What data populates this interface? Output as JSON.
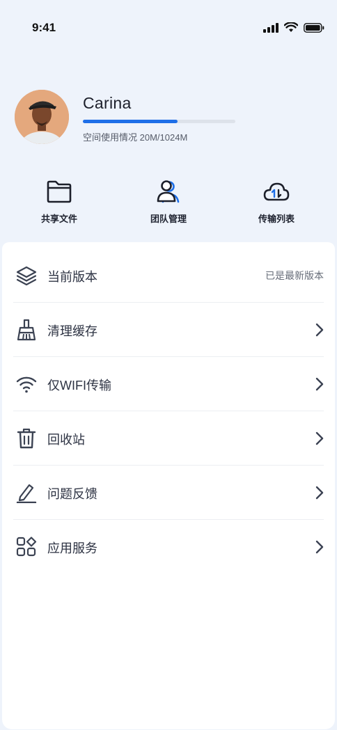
{
  "status": {
    "time": "9:41"
  },
  "profile": {
    "name": "Carina",
    "usage_label": "空间使用情况",
    "usage_amount": "20M/1024M",
    "usage_fraction": 0.62
  },
  "quick_actions": [
    {
      "label": "共享文件",
      "icon": "folder-icon"
    },
    {
      "label": "团队管理",
      "icon": "team-icon"
    },
    {
      "label": "传输列表",
      "icon": "cloud-transfer-icon"
    }
  ],
  "menu": [
    {
      "label": "当前版本",
      "icon": "layers-icon",
      "value": "已是最新版本"
    },
    {
      "label": "清理缓存",
      "icon": "broom-icon"
    },
    {
      "label": "仅WIFI传输",
      "icon": "wifi-icon"
    },
    {
      "label": "回收站",
      "icon": "trash-icon"
    },
    {
      "label": "问题反馈",
      "icon": "edit-icon"
    },
    {
      "label": "应用服务",
      "icon": "apps-icon"
    }
  ],
  "colors": {
    "accent": "#1e6fe8",
    "background": "#eef3fb",
    "panel": "#ffffff"
  }
}
